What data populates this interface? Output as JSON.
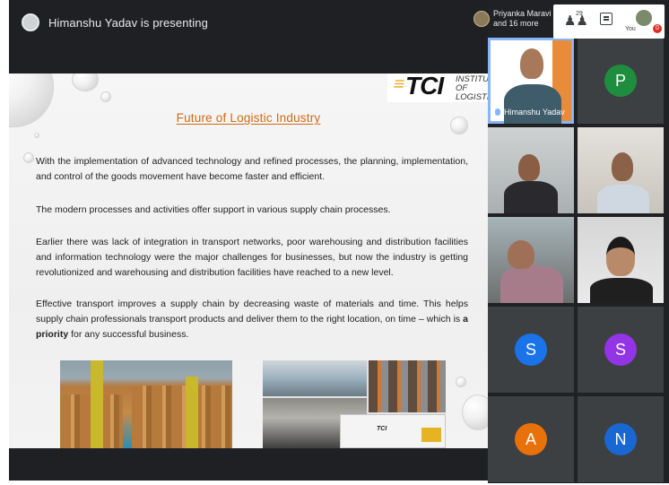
{
  "meeting": {
    "presenting_text": "Himanshu Yadav is presenting",
    "participants_preview": "Priyanka Maravi and 16 more",
    "participants_preview_line1": "Priyanka Maravi",
    "participants_preview_line2": "and 16 more",
    "people_count": "29",
    "self_label": "You",
    "notification_badge": "0"
  },
  "slide": {
    "logo_text": "TCI",
    "logo_institute_line1": "INSTITUTE OF",
    "logo_institute_line2": "LOGISTICS",
    "title": "Future of Logistic Industry",
    "paragraphs": [
      "With the implementation of advanced technology and refined processes, the planning, implementation, and control of the goods movement have become faster and efficient.",
      "The modern processes and activities offer support in various supply chain processes.",
      "Earlier there was lack of integration in transport networks, poor warehousing and distribution facilities and information technology were the major challenges for businesses, but now the industry is getting revolutionized and warehousing and distribution facilities have reached to a new level."
    ],
    "last_paragraph_start": "Effective transport improves a supply chain by decreasing waste of materials and time. This helps supply chain professionals transport products and deliver them to the right location, on time – which is ",
    "last_paragraph_bold": "a priority",
    "last_paragraph_end": " for any successful business.",
    "truck_label": "TCI"
  },
  "participants": [
    {
      "type": "video",
      "name": "Himanshu Yadav",
      "speaking": true
    },
    {
      "type": "letter",
      "letter": "P",
      "color": "#1e8e3e"
    },
    {
      "type": "video"
    },
    {
      "type": "video"
    },
    {
      "type": "video"
    },
    {
      "type": "video"
    },
    {
      "type": "letter",
      "letter": "S",
      "color": "#1a73e8"
    },
    {
      "type": "letter",
      "letter": "S",
      "color": "#9334e6"
    },
    {
      "type": "letter",
      "letter": "A",
      "color": "#e8710a"
    },
    {
      "type": "letter",
      "letter": "N",
      "color": "#1967d2"
    }
  ],
  "colors": {
    "title": "#d06a12",
    "meeting_bg": "#202124",
    "slide_bg": "#f3f3f3"
  }
}
